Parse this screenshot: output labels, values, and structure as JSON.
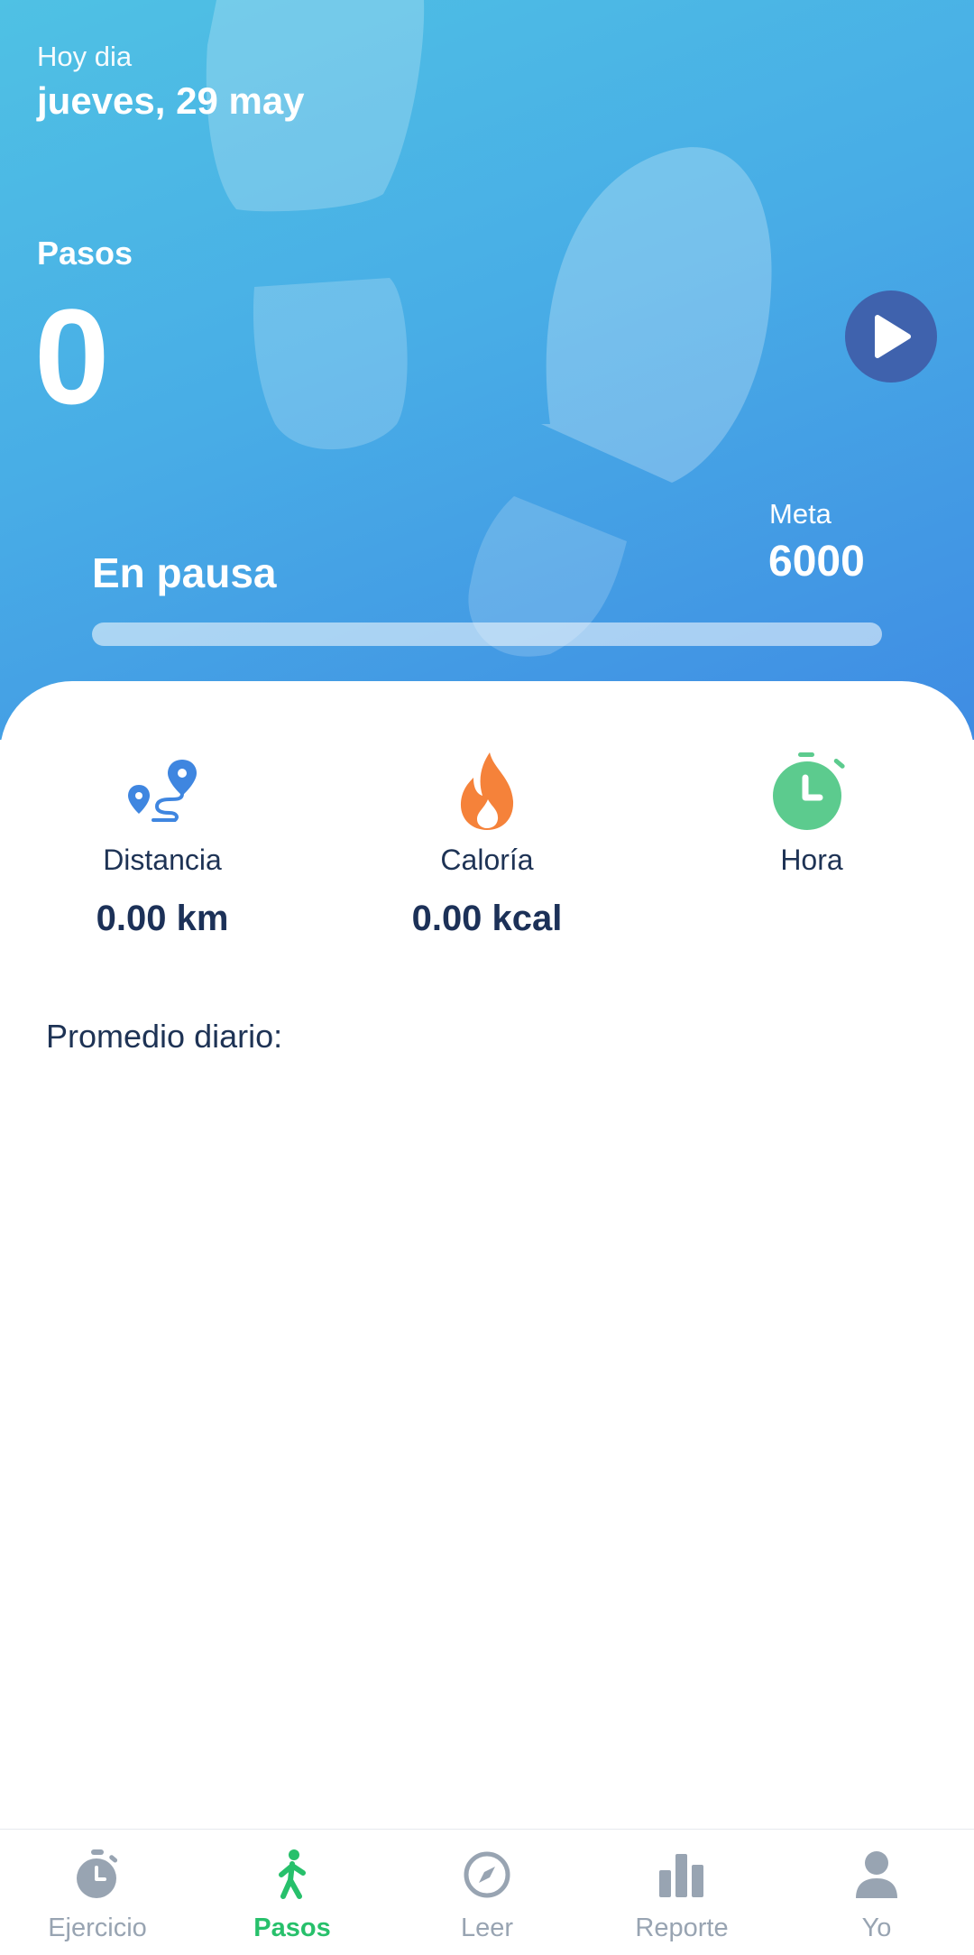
{
  "header": {
    "today_label": "Hoy dia",
    "date": "jueves, 29 may",
    "steps_label": "Pasos",
    "steps_value": "0",
    "status": "En pausa",
    "goal_label": "Meta",
    "goal_value": "6000",
    "progress_fraction": 0,
    "play_icon": "play-icon"
  },
  "stats": {
    "distance": {
      "label": "Distancia",
      "value": "0.00 km",
      "icon": "route-icon"
    },
    "calories": {
      "label": "Caloría",
      "value": "0.00 kcal",
      "icon": "flame-icon"
    },
    "time": {
      "label": "Hora",
      "value": "",
      "icon": "stopwatch-icon"
    }
  },
  "daily_average_label": "Promedio diario:",
  "nav": {
    "items": [
      {
        "label": "Ejercicio",
        "icon": "stopwatch-icon",
        "active": false
      },
      {
        "label": "Pasos",
        "icon": "walking-icon",
        "active": true
      },
      {
        "label": "Leer",
        "icon": "compass-icon",
        "active": false
      },
      {
        "label": "Reporte",
        "icon": "bar-chart-icon",
        "active": false
      },
      {
        "label": "Yo",
        "icon": "user-icon",
        "active": false
      }
    ]
  },
  "colors": {
    "hero_gradient_start": "#4fc1e4",
    "hero_gradient_end": "#3f8ce3",
    "play_button": "#3f62ad",
    "active_nav": "#27c06b",
    "inactive_nav": "#98a4b2",
    "distance_icon": "#3f86e0",
    "calories_icon": "#f5823a",
    "time_icon": "#5ccb8e"
  }
}
